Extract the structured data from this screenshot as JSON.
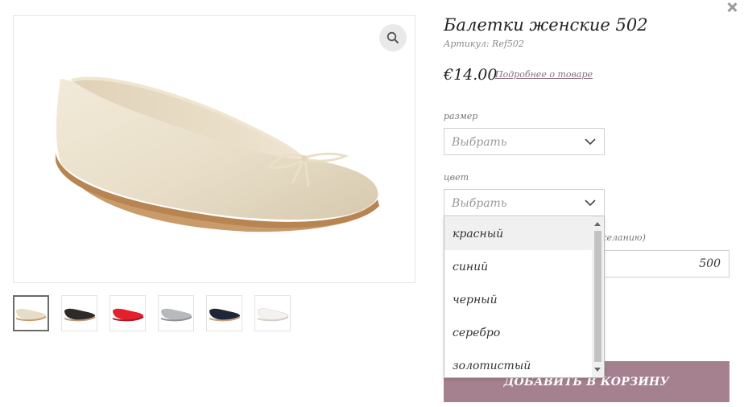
{
  "product": {
    "title": "Балетки женские 502",
    "sku": "Артикул: Ref502",
    "price": "€14.00",
    "more_link": "Подробнее о товаре"
  },
  "size": {
    "label": "размер",
    "value": "Выбрать"
  },
  "color": {
    "label": "цвет",
    "value": "Выбрать",
    "options": [
      "красный",
      "синий",
      "черный",
      "серебро",
      "золотистый"
    ],
    "highlighted": "красный"
  },
  "extra": {
    "label_visible": "желанию)",
    "value": "500"
  },
  "cart": {
    "add_label": "ДОБАВИТЬ В КОРЗИНУ"
  },
  "thumbnails": [
    {
      "name": "beige",
      "color": "#e7dcc6"
    },
    {
      "name": "black",
      "color": "#2d2a28"
    },
    {
      "name": "red",
      "color": "#e3202b"
    },
    {
      "name": "silver",
      "color": "#b7b9bc"
    },
    {
      "name": "navy",
      "color": "#1f2638"
    },
    {
      "name": "white",
      "color": "#f3f2ee"
    }
  ],
  "colors": {
    "accent": "#a5808f",
    "link": "#8a6d7e"
  }
}
